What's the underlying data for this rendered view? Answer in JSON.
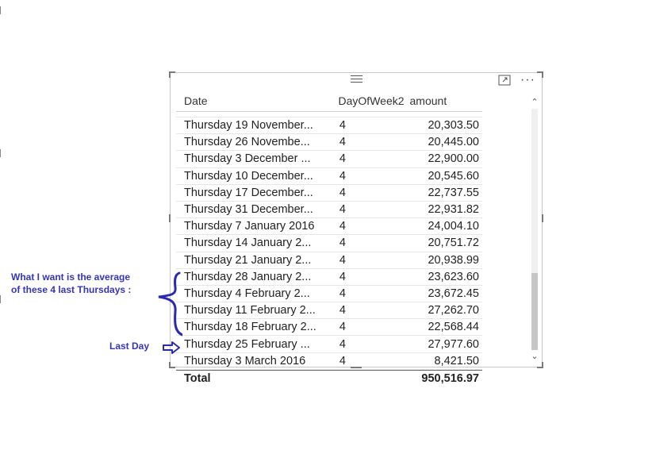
{
  "table": {
    "headers": {
      "date": "Date",
      "day_of_week": "DayOfWeek2",
      "amount": "amount"
    },
    "rows": [
      {
        "date": "Thursday 19 November...",
        "day": "4",
        "amount": "20,303.50"
      },
      {
        "date": "Thursday 26 Novembe...",
        "day": "4",
        "amount": "20,445.00"
      },
      {
        "date": "Thursday 3 December ...",
        "day": "4",
        "amount": "22,900.00"
      },
      {
        "date": "Thursday 10 December...",
        "day": "4",
        "amount": "20,545.60"
      },
      {
        "date": "Thursday 17 December...",
        "day": "4",
        "amount": "22,737.55"
      },
      {
        "date": "Thursday 31 December...",
        "day": "4",
        "amount": "22,931.82"
      },
      {
        "date": "Thursday 7 January 2016",
        "day": "4",
        "amount": "24,004.10"
      },
      {
        "date": "Thursday 14 January 2...",
        "day": "4",
        "amount": "20,751.72"
      },
      {
        "date": "Thursday 21 January 2...",
        "day": "4",
        "amount": "20,938.99"
      },
      {
        "date": "Thursday 28 January 2...",
        "day": "4",
        "amount": "23,623.60"
      },
      {
        "date": "Thursday 4 February 2...",
        "day": "4",
        "amount": "23,672.45"
      },
      {
        "date": "Thursday 11 February 2...",
        "day": "4",
        "amount": "27,262.70"
      },
      {
        "date": "Thursday 18 February 2...",
        "day": "4",
        "amount": "22,568.44"
      },
      {
        "date": "Thursday 25 February ...",
        "day": "4",
        "amount": "27,977.60"
      },
      {
        "date": "Thursday 3 March 2016",
        "day": "4",
        "amount": "8,421.50"
      }
    ],
    "total": {
      "label": "Total",
      "amount": "950,516.97"
    }
  },
  "annotations": {
    "average_note_line1": "What I want is the average",
    "average_note_line2": "of these 4 last Thursdays :",
    "last_day_label": "Last Day"
  },
  "icons": {
    "focus": "focus-mode-icon",
    "more": "more-options-icon",
    "scroll_up": "chevron-up-icon",
    "scroll_down": "chevron-down-icon"
  },
  "colors": {
    "annotation": "#3535b8"
  }
}
